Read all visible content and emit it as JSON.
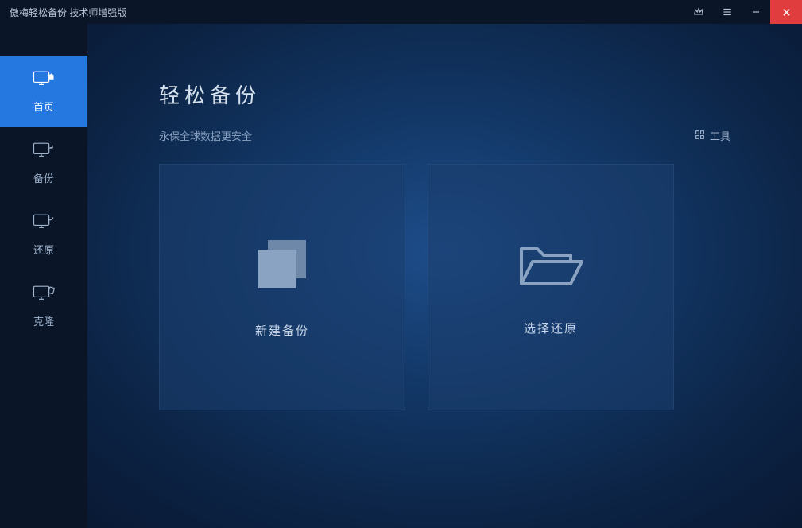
{
  "titlebar": {
    "title": "傲梅轻松备份 技术师增强版"
  },
  "sidebar": {
    "items": [
      {
        "label": "首页"
      },
      {
        "label": "备份"
      },
      {
        "label": "还原"
      },
      {
        "label": "克隆"
      }
    ]
  },
  "main": {
    "title": "轻松备份",
    "subtitle": "永保全球数据更安全",
    "tools_label": "工具",
    "cards": [
      {
        "label": "新建备份"
      },
      {
        "label": "选择还原"
      }
    ]
  }
}
